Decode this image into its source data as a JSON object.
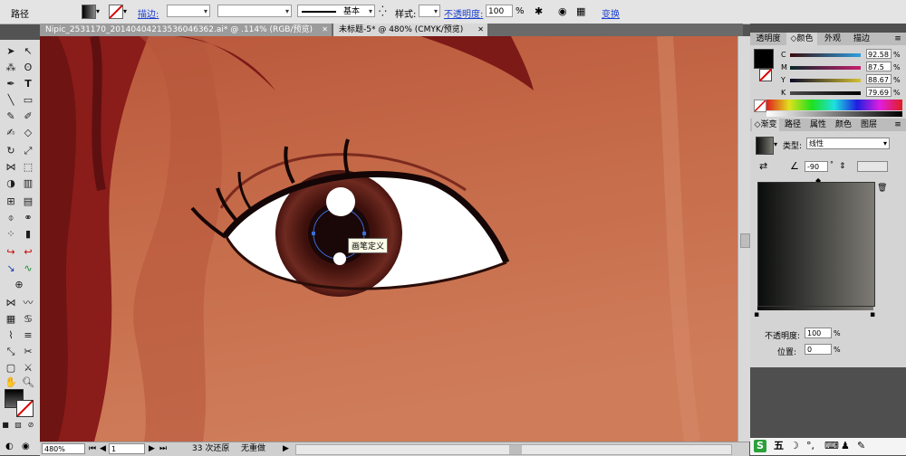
{
  "control_bar": {
    "object_type": "路径",
    "stroke_label": "描边:",
    "stroke_profile": "基本",
    "style_label": "样式:",
    "opacity_label": "不透明度:",
    "opacity_value": "100",
    "opacity_unit": "%",
    "transform_label": "变换"
  },
  "tabs": [
    {
      "label": "Nipic_2531170_20140404213536046362.ai* @ .114% (RGB/预览)",
      "active": false
    },
    {
      "label": "未标题-5* @ 480% (CMYK/预览)",
      "active": true
    }
  ],
  "tooltip": "画笔定义",
  "status": {
    "zoom": "480%",
    "page": "1",
    "undo_text": "33 次还原",
    "redo_text": "无重做"
  },
  "color_panel": {
    "tabs": [
      "透明度",
      "颜色",
      "外观",
      "描边"
    ],
    "active_tab": "颜色",
    "channels": [
      {
        "name": "C",
        "value": "92.58",
        "unit": "%"
      },
      {
        "name": "M",
        "value": "87.5",
        "unit": "%"
      },
      {
        "name": "Y",
        "value": "88.67",
        "unit": "%"
      },
      {
        "name": "K",
        "value": "79.69",
        "unit": "%"
      }
    ]
  },
  "gradient_panel": {
    "tabs": [
      "渐变",
      "路径",
      "属性",
      "颜色",
      "图层"
    ],
    "active_tab": "渐变",
    "type_label": "类型:",
    "type_value": "线性",
    "angle_value": "-90",
    "angle_unit": "°",
    "opacity_label": "不透明度:",
    "opacity_value": "100",
    "opacity_unit": "%",
    "position_label": "位置:",
    "position_value": "0",
    "position_unit": "%"
  },
  "taskbar": {
    "ime_label": "五"
  },
  "colors": {
    "gradient_start": "#0b0d0c",
    "gradient_end": "#7d7b74",
    "skin": "#c36a48",
    "hair": "#8a1c1a",
    "iris": "#4a1410"
  }
}
